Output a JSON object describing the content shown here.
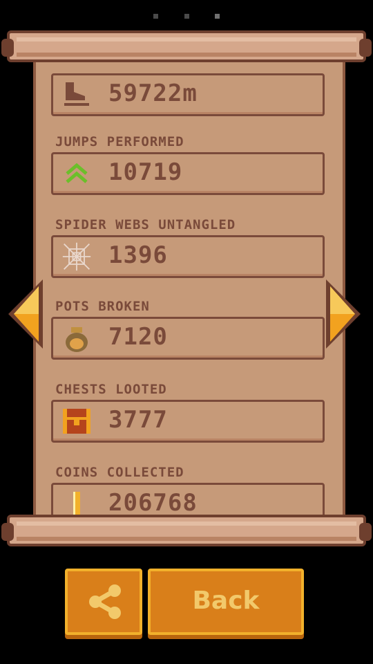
{
  "pagination": {
    "count": 3,
    "active_index": 2
  },
  "stats": [
    {
      "label": "",
      "value": "59722m",
      "icon": "skate-icon"
    },
    {
      "label": "JUMPS PERFORMED",
      "value": "10719",
      "icon": "double-chevron-up-icon"
    },
    {
      "label": "SPIDER WEBS UNTANGLED",
      "value": "1396",
      "icon": "spider-web-icon"
    },
    {
      "label": "POTS BROKEN",
      "value": "7120",
      "icon": "pot-icon"
    },
    {
      "label": "CHESTS LOOTED",
      "value": "3777",
      "icon": "chest-icon"
    },
    {
      "label": "COINS COLLECTED",
      "value": "206768",
      "icon": "coin-icon"
    }
  ],
  "buttons": {
    "share_icon": "share-icon",
    "back_label": "Back"
  },
  "colors": {
    "parchment": "#c69a79",
    "text": "#7a4a3a",
    "button": "#d97f1a",
    "button_border": "#f2b12b"
  }
}
